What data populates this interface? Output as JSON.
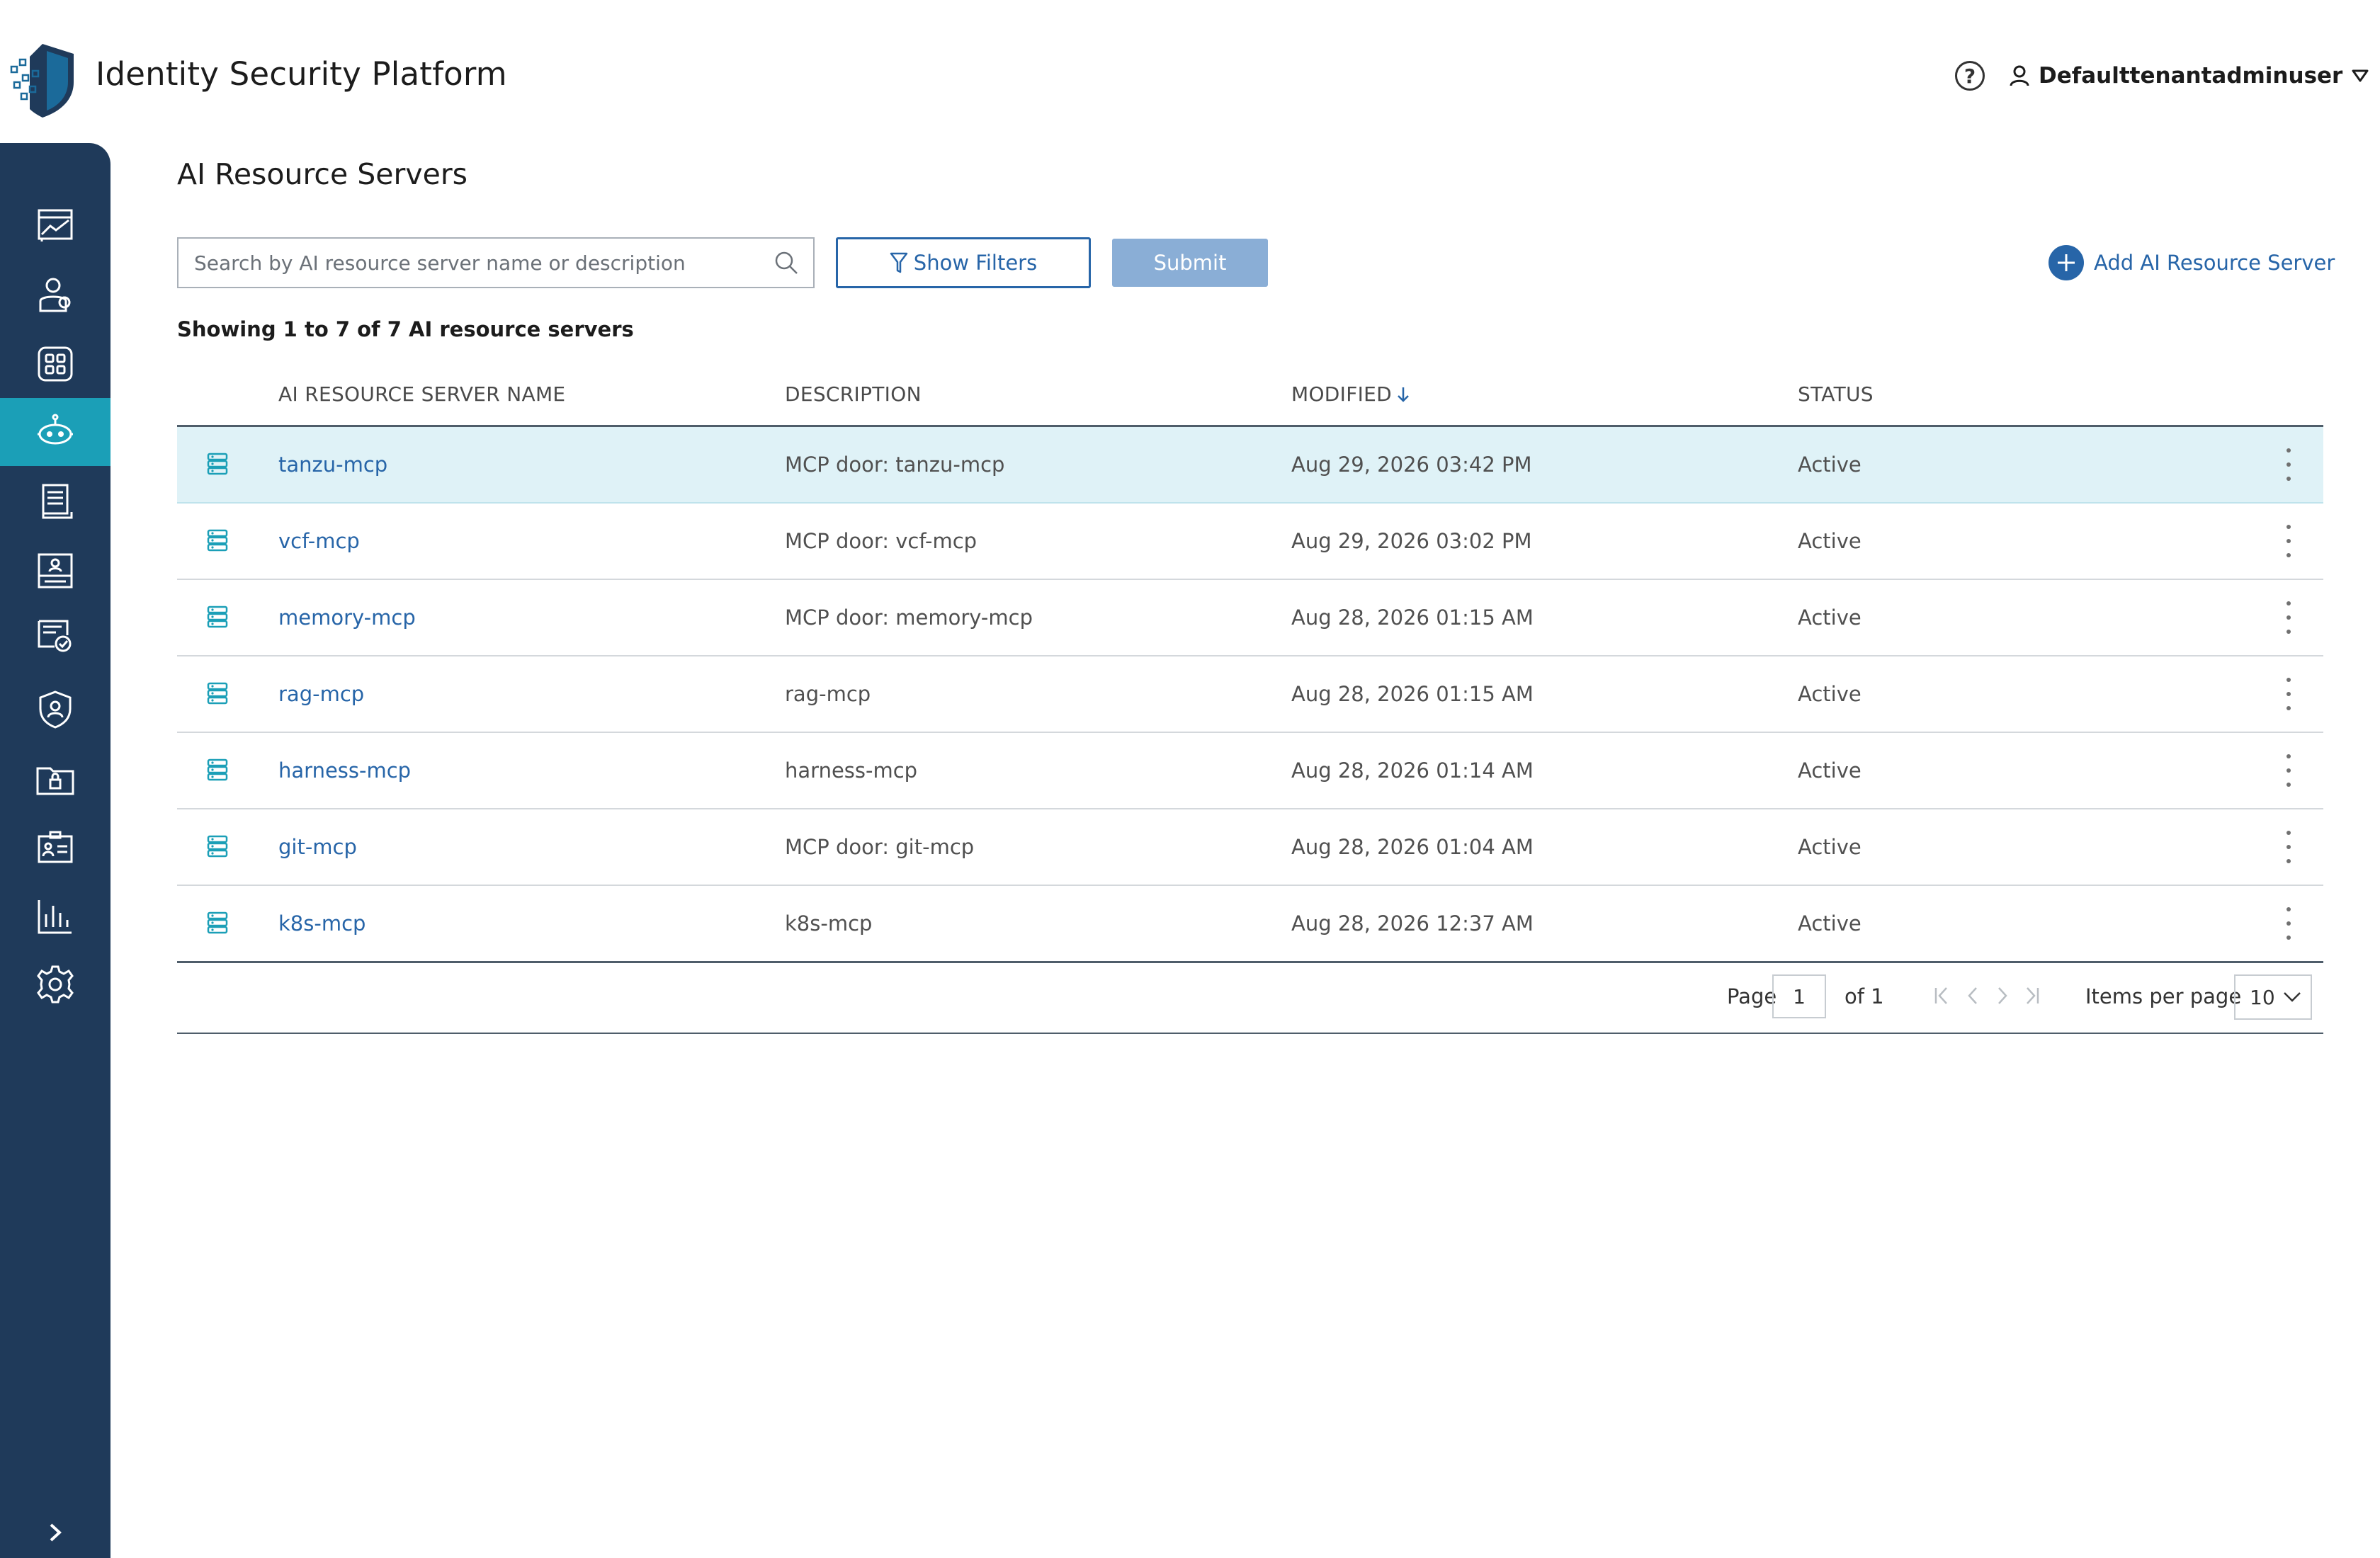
{
  "app": {
    "title": "Identity Security Platform",
    "user_name": "Defaulttenantadminuser",
    "help_glyph": "?",
    "brand_color": "#1f3a5a",
    "accent_color": "#1b9fb7",
    "link_color": "#2765a8"
  },
  "sidebar": {
    "items": [
      {
        "icon": "dashboard-chart-icon",
        "active": false
      },
      {
        "icon": "users-icon",
        "active": false
      },
      {
        "icon": "apps-grid-icon",
        "active": false
      },
      {
        "icon": "ai-robot-icon",
        "active": true
      },
      {
        "icon": "policy-document-icon",
        "active": false
      },
      {
        "icon": "access-request-icon",
        "active": false
      },
      {
        "icon": "certification-icon",
        "active": false
      },
      {
        "icon": "shield-user-icon",
        "active": false
      },
      {
        "icon": "secure-folder-icon",
        "active": false
      },
      {
        "icon": "identity-card-icon",
        "active": false
      },
      {
        "icon": "reports-bar-chart-icon",
        "active": false
      },
      {
        "icon": "settings-gear-icon",
        "active": false
      }
    ],
    "expand_icon": "chevron-right-icon"
  },
  "page": {
    "title": "AI Resource Servers",
    "search_placeholder": "Search by AI resource server name or description",
    "show_filters_label": "Show Filters",
    "submit_label": "Submit",
    "add_label": "Add AI Resource Server",
    "showing_text": "Showing 1 to 7 of 7 AI resource servers"
  },
  "table": {
    "columns": [
      "AI RESOURCE SERVER NAME",
      "DESCRIPTION",
      "MODIFIED",
      "STATUS"
    ],
    "sort_column": "MODIFIED",
    "sort_direction": "descending",
    "rows": [
      {
        "name": "tanzu-mcp",
        "description": "MCP door: tanzu-mcp",
        "modified": "Aug 29, 2026 03:42 PM",
        "status": "Active"
      },
      {
        "name": "vcf-mcp",
        "description": "MCP door: vcf-mcp",
        "modified": "Aug 29, 2026 03:02 PM",
        "status": "Active"
      },
      {
        "name": "memory-mcp",
        "description": "MCP door: memory-mcp",
        "modified": "Aug 28, 2026 01:15 AM",
        "status": "Active"
      },
      {
        "name": "rag-mcp",
        "description": "rag-mcp",
        "modified": "Aug 28, 2026 01:15 AM",
        "status": "Active"
      },
      {
        "name": "harness-mcp",
        "description": "harness-mcp",
        "modified": "Aug 28, 2026 01:14 AM",
        "status": "Active"
      },
      {
        "name": "git-mcp",
        "description": "MCP door: git-mcp",
        "modified": "Aug 28, 2026 01:04 AM",
        "status": "Active"
      },
      {
        "name": "k8s-mcp",
        "description": "k8s-mcp",
        "modified": "Aug 28, 2026 12:37 AM",
        "status": "Active"
      }
    ]
  },
  "pagination": {
    "page_label": "Page",
    "current_page": "1",
    "of_label": "of 1",
    "items_per_page_label": "Items per page",
    "items_per_page": "10"
  }
}
